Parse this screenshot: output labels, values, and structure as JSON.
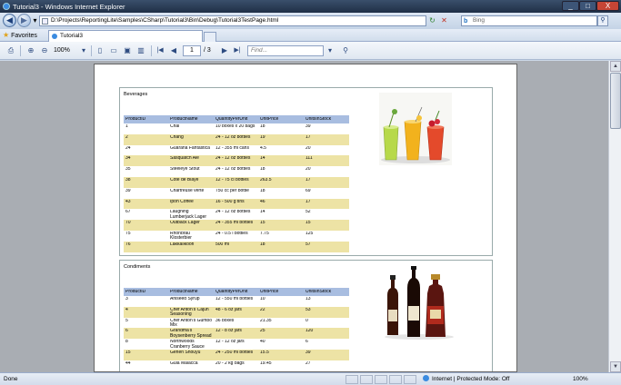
{
  "window": {
    "title": "Tutorial3 - Windows Internet Explorer",
    "min": "_",
    "max": "□",
    "close": "X"
  },
  "address": {
    "url": "D:\\Projects\\ReportingLite\\Samples\\CSharp\\Tutorial3\\Bin\\Debug\\Tutorial3TestPage.html",
    "back": "◀",
    "forward": "▶",
    "dropdown": "▾",
    "refresh": "↻",
    "stop": "✕",
    "search_placeholder": "Bing",
    "search_brand": "b",
    "search_go": "⚲"
  },
  "favorites": {
    "label": "Favorites",
    "star": "★",
    "tab_title": "Tutorial3"
  },
  "toolbar": {
    "print": "⎙",
    "zoom_in": "⊕",
    "zoom_out": "⊖",
    "zoom": "100%",
    "zoom_dropdown": "▾",
    "single_page": "▯",
    "page_width": "▭",
    "whole_page": "▣",
    "two_pages": "▥",
    "first": "|◀",
    "prev": "◀",
    "page_number": "1",
    "page_count": "/ 3",
    "next": "▶",
    "last": "▶|",
    "find_placeholder": "Find...",
    "find_dropdown": "▾",
    "find_go": "⚲"
  },
  "report": {
    "columns": [
      "ProductID",
      "ProductName",
      "QuantityPerUnit",
      "UnitPrice",
      "UnitsInStock"
    ],
    "categories": [
      {
        "name": "Beverages",
        "rows": [
          [
            "1",
            "Chai",
            "10 boxes x 20 bags",
            "18",
            "39"
          ],
          [
            "2",
            "Chang",
            "24 - 12 oz bottles",
            "19",
            "17"
          ],
          [
            "24",
            "Guaraná Fantástica",
            "12 - 355 ml cans",
            "4.5",
            "20"
          ],
          [
            "34",
            "Sasquatch Ale",
            "24 - 12 oz bottles",
            "14",
            "111"
          ],
          [
            "35",
            "Steeleye Stout",
            "24 - 12 oz bottles",
            "18",
            "20"
          ],
          [
            "38",
            "Côte de Blaye",
            "12 - 75 cl bottles",
            "263.5",
            "17"
          ],
          [
            "39",
            "Chartreuse verte",
            "750 cc per bottle",
            "18",
            "69"
          ],
          [
            "43",
            "Ipoh Coffee",
            "16 - 500 g tins",
            "46",
            "17"
          ],
          [
            "67",
            "Laughing Lumberjack Lager",
            "24 - 12 oz bottles",
            "14",
            "52"
          ],
          [
            "70",
            "Outback Lager",
            "24 - 355 ml bottles",
            "15",
            "15"
          ],
          [
            "75",
            "Rhönbräu Klosterbier",
            "24 - 0.5 l bottles",
            "7.75",
            "125"
          ],
          [
            "76",
            "Lakkalikööri",
            "500 ml",
            "18",
            "57"
          ]
        ]
      },
      {
        "name": "Condiments",
        "rows": [
          [
            "3",
            "Aniseed Syrup",
            "12 - 550 ml bottles",
            "10",
            "13"
          ],
          [
            "4",
            "Chef Anton's Cajun Seasoning",
            "48 - 6 oz jars",
            "22",
            "53"
          ],
          [
            "5",
            "Chef Anton's Gumbo Mix",
            "36 boxes",
            "21.35",
            "0"
          ],
          [
            "6",
            "Grandma's Boysenberry Spread",
            "12 - 8 oz jars",
            "25",
            "120"
          ],
          [
            "8",
            "Northwoods Cranberry Sauce",
            "12 - 12 oz jars",
            "40",
            "6"
          ],
          [
            "15",
            "Genen Shouyu",
            "24 - 250 ml bottles",
            "15.5",
            "39"
          ],
          [
            "44",
            "Gula Malacca",
            "20 - 2 kg bags",
            "19.45",
            "27"
          ],
          [
            "61",
            "Sirop d'érable",
            "24 - 500 ml bottles",
            "28.5",
            "113"
          ]
        ]
      }
    ]
  },
  "status": {
    "text": "Done",
    "zone": "Internet | Protected Mode: Off",
    "zoom": "100%"
  },
  "colors": {
    "header_row": "#a8bde0",
    "alt_row": "#ede3a5"
  }
}
